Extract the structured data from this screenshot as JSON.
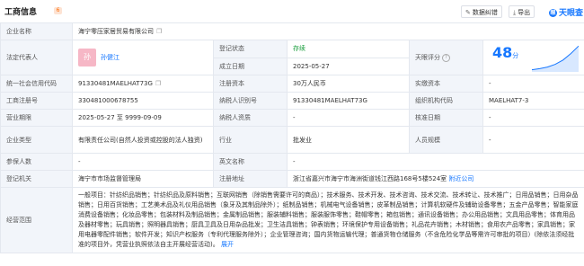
{
  "header": {
    "title": "工商信息",
    "badge": "6",
    "btn_correction": "数据纠错",
    "btn_export": "导出",
    "logo": "天眼查",
    "logo_mark": "眼"
  },
  "rows": {
    "company_name_label": "企业名称",
    "company_name": "海宁零压家居贸易有限公司",
    "legal_rep_label": "法定代表人",
    "legal_rep_avatar": "孙",
    "legal_rep": "孙健江",
    "reg_status_label": "登记状态",
    "reg_status": "存续",
    "est_date_label": "成立日期",
    "est_date": "2025-05-27",
    "score_label": "天眼评分",
    "score_value": "48",
    "score_unit": "分",
    "credit_code_label": "统一社会信用代码",
    "credit_code": "91330481MAELHAT73G",
    "reg_capital_label": "注册资本",
    "reg_capital": "30万人民币",
    "paid_capital_label": "实缴资本",
    "paid_capital": "-",
    "biz_reg_no_label": "工商注册号",
    "biz_reg_no": "330481000678755",
    "tax_id_label": "纳税人识别号",
    "tax_id": "91330481MAELHAT73G",
    "org_code_label": "组织机构代码",
    "org_code": "MAELHAT7-3",
    "term_label": "营业期限",
    "term": "2025-05-27 至 9999-09-09",
    "taxpayer_qual_label": "纳税人资质",
    "taxpayer_qual": "-",
    "approval_date_label": "核准日期",
    "approval_date": "-",
    "type_label": "企业类型",
    "type": "有限责任公司(自然人投资或控股的法人独资)",
    "industry_label": "行业",
    "industry": "批发业",
    "staff_label": "人员规模",
    "staff": "-",
    "insured_label": "参保人数",
    "insured": "-",
    "en_name_label": "英文名称",
    "en_name": "-",
    "authority_label": "登记机关",
    "authority": "海宁市市场监督管理局",
    "address_label": "注册地址",
    "address": "浙江省嘉兴市海宁市海洲街道钱江西路168号5楼524室",
    "nearby": "附近公司",
    "scope_label": "经营范围",
    "scope": "一般项目：针纺织品销售；针纺织品及原料销售；互联网销售（除销售需要许可的商品）；技术服务、技术开发、技术咨询、技术交流、技术转让、技术推广；日用品销售；日用杂品销售；日用百货销售；工艺美术品及礼仪用品销售（象牙及其制品除外）；纸制品销售；机械电气设备销售；皮革制品销售；计算机软硬件及辅助设备零售；五金产品零售；智能家庭消费设备销售；化妆品零售；包装材料及制品销售；金属制品销售；服装辅料销售；服装服饰零售；鞋帽零售；箱包销售；通讯设备销售；办公用品销售；文具用品零售；体育用品及器材零售；玩具销售；照明器具销售；厨具卫具及日用杂品批发；卫生洁具销售；钟表销售；环境保护专用设备销售；礼品花卉销售；木材销售；食用农产品零售；家具销售；家用电器零配件销售；软件开发；知识产权服务（专利代理服务除外）；企业管理咨询；国内货物运输代理；普通货物仓储服务（不含危险化学品等需许可审批的项目）(除依法须经批准的项目外，凭营业执照依法自主开展经营活动)。",
    "scope_more": "展开"
  },
  "score_spark": [
    4,
    6,
    9,
    14,
    22,
    34,
    48
  ]
}
